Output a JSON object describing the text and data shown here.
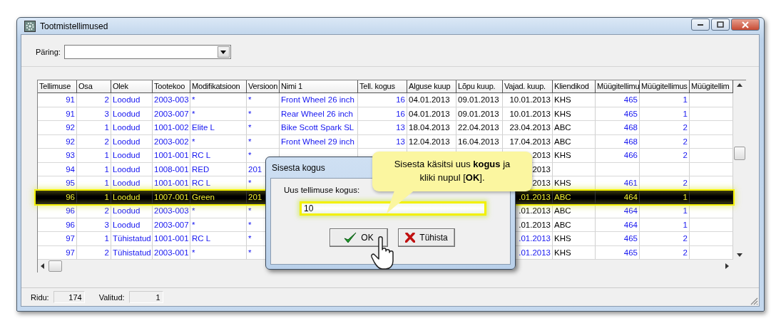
{
  "window": {
    "title": "Tootmistellimused"
  },
  "query": {
    "label": "Päring:"
  },
  "table": {
    "columns": [
      {
        "label": "Tellimuse",
        "numeric": true,
        "link": true
      },
      {
        "label": "Osa",
        "numeric": true,
        "link": true
      },
      {
        "label": "Olek",
        "numeric": false,
        "link": true
      },
      {
        "label": "Tootekoo",
        "numeric": false,
        "link": true
      },
      {
        "label": "Modifikatsioon",
        "numeric": false,
        "link": true
      },
      {
        "label": "Versioon",
        "numeric": false,
        "link": true
      },
      {
        "label": "Nimi 1",
        "numeric": false,
        "link": true
      },
      {
        "label": "Tell. kogus",
        "numeric": true,
        "link": true
      },
      {
        "label": "Alguse kuup",
        "numeric": false,
        "link": false
      },
      {
        "label": "Lõpu kuup.",
        "numeric": false,
        "link": false
      },
      {
        "label": "Vajad. kuup.",
        "numeric": true,
        "link": false
      },
      {
        "label": "Kliendikod",
        "numeric": false,
        "link": false
      },
      {
        "label": "Müügitellimu",
        "numeric": true,
        "link": true
      },
      {
        "label": "Müügitellimus",
        "numeric": true,
        "link": true
      },
      {
        "label": "Müügitellim"
      }
    ],
    "rows": [
      {
        "selected": false,
        "cells": [
          "91",
          "2",
          "Loodud",
          "2003-003",
          "*",
          "*",
          "Front Wheel 26 inch",
          "16",
          "04.01.2013",
          "09.01.2013",
          "10.01.2013",
          "KHS",
          "465",
          "1",
          null
        ]
      },
      {
        "selected": false,
        "cells": [
          "91",
          "3",
          "Loodud",
          "2003-007",
          "*",
          "*",
          "Rear Wheel 26 inch",
          "16",
          "04.01.2013",
          "09.01.2013",
          "10.01.2013",
          "KHS",
          "465",
          "1",
          null
        ]
      },
      {
        "selected": false,
        "cells": [
          "92",
          "1",
          "Loodud",
          "1001-002",
          "Elite L",
          "*",
          "Bike Scott Spark SL",
          "13",
          "18.04.2013",
          "22.04.2013",
          "23.04.2013",
          "ABC",
          "468",
          "2",
          null
        ]
      },
      {
        "selected": false,
        "cells": [
          "92",
          "2",
          "Loodud",
          "2003-002",
          "*",
          "*",
          "Front Wheel 29 inch",
          "13",
          "12.04.2013",
          "16.04.2013",
          "17.04.2013",
          "ABC",
          "468",
          "2",
          null
        ]
      },
      {
        "selected": false,
        "cells": [
          "93",
          "1",
          "Loodud",
          "1001-001",
          "RC L",
          "*",
          null,
          null,
          null,
          null,
          "2013",
          "KHS",
          "466",
          "2",
          null
        ]
      },
      {
        "selected": false,
        "cells": [
          "94",
          "1",
          "Loodud",
          "1008-001",
          "RED",
          "201",
          null,
          null,
          null,
          null,
          "2013",
          null,
          null,
          null,
          null
        ]
      },
      {
        "selected": false,
        "cells": [
          "95",
          "1",
          "Loodud",
          "1001-001",
          "RC L",
          "*",
          null,
          null,
          null,
          null,
          "2013",
          "KHS",
          "461",
          "2",
          null
        ]
      },
      {
        "selected": true,
        "cells": [
          "96",
          "1",
          "Loodud",
          "1007-001",
          "Green",
          "201",
          null,
          null,
          null,
          null,
          ".01.2013",
          "ABC",
          "464",
          "1",
          null
        ]
      },
      {
        "selected": false,
        "cells": [
          "96",
          "2",
          "Loodud",
          "2003-003",
          "*",
          "*",
          null,
          null,
          null,
          null,
          ".01.2013",
          "ABC",
          "464",
          "1",
          null
        ]
      },
      {
        "selected": false,
        "cells": [
          "96",
          "3",
          "Loodud",
          "2003-007",
          "*",
          "*",
          null,
          null,
          null,
          null,
          ".01.2013",
          "ABC",
          "464",
          "1",
          null
        ]
      },
      {
        "selected": false,
        "cells": [
          "97",
          "1",
          "Tühistatud",
          "1001-001",
          "RC L",
          "*",
          null,
          null,
          null,
          null,
          {
            "text": ".01.2013",
            "link": true
          },
          "KHS",
          "465",
          "2",
          null
        ]
      },
      {
        "selected": false,
        "cells": [
          "97",
          "2",
          "Tühistatud",
          "2003-001",
          "*",
          "*",
          null,
          null,
          null,
          null,
          {
            "text": ".01.2013",
            "link": true
          },
          "KHS",
          "465",
          "2",
          null
        ]
      }
    ]
  },
  "status_bar": [
    {
      "label": "Ridu:",
      "value": "174"
    },
    {
      "label": "Valitud:",
      "value": "1"
    }
  ],
  "dialog": {
    "title": "Sisesta kogus",
    "field_label": "Uus tellimuse kogus:",
    "value": "10",
    "buttons": [
      {
        "label": "OK",
        "kind": "ok"
      },
      {
        "label": "Tühista",
        "kind": "cancel"
      }
    ]
  },
  "callout": {
    "text": "Sisesta käsitsi uus **kogus** ja kliki nupul [**OK**]."
  }
}
